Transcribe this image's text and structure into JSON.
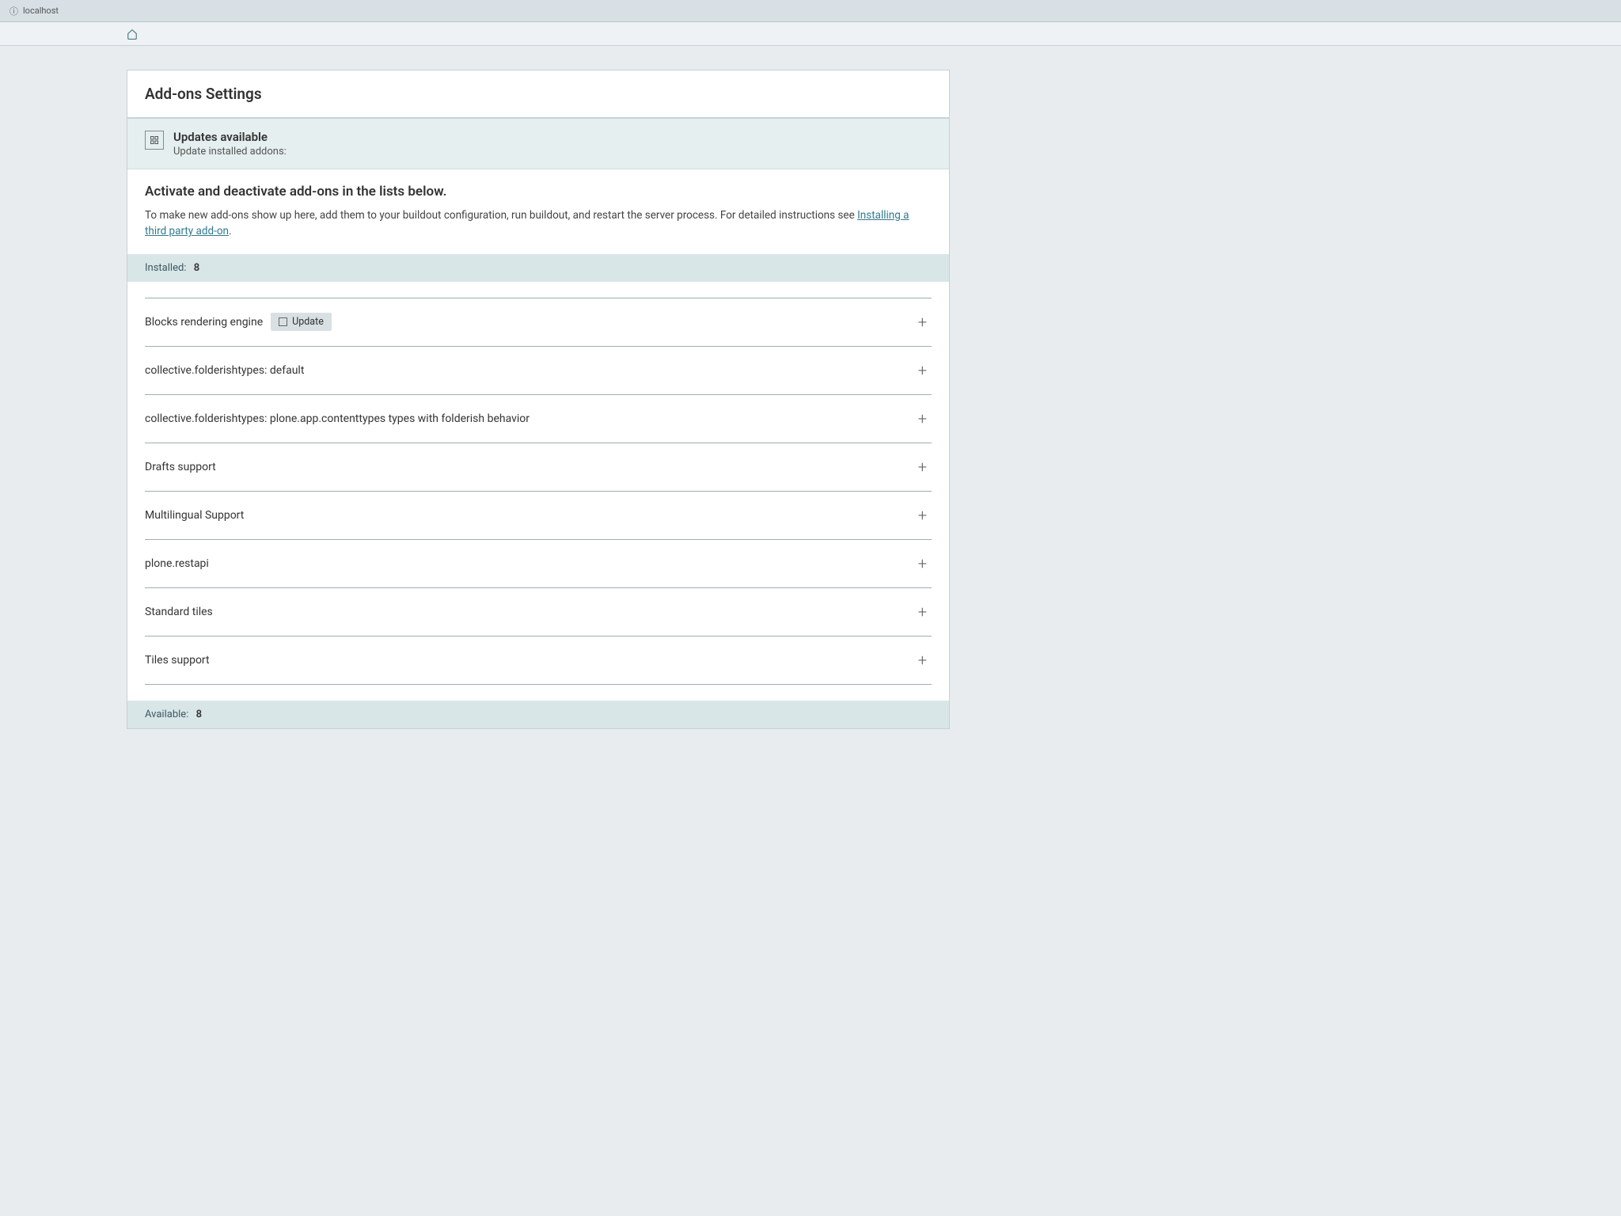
{
  "browser": {
    "url_prefix": "localhost"
  },
  "page_title": "Add-ons Settings",
  "updates_banner": {
    "title": "Updates available",
    "subtitle": "Update installed addons:"
  },
  "info_section": {
    "heading": "Activate and deactivate add-ons in the lists below.",
    "body_prefix": "To make new add-ons show up here, add them to your buildout configuration, run buildout, and restart the server process. For detailed instructions see ",
    "link_text": "Installing a third party add-on",
    "body_suffix": "."
  },
  "installed": {
    "label": "Installed:",
    "count": "8",
    "items": [
      {
        "name": "Blocks rendering engine",
        "has_update": true,
        "update_label": "Update"
      },
      {
        "name": "collective.folderishtypes: default",
        "has_update": false
      },
      {
        "name": "collective.folderishtypes: plone.app.contenttypes types with folderish behavior",
        "has_update": false
      },
      {
        "name": "Drafts support",
        "has_update": false
      },
      {
        "name": "Multilingual Support",
        "has_update": false
      },
      {
        "name": "plone.restapi",
        "has_update": false
      },
      {
        "name": "Standard tiles",
        "has_update": false
      },
      {
        "name": "Tiles support",
        "has_update": false
      }
    ]
  },
  "available": {
    "label": "Available:",
    "count": "8"
  }
}
